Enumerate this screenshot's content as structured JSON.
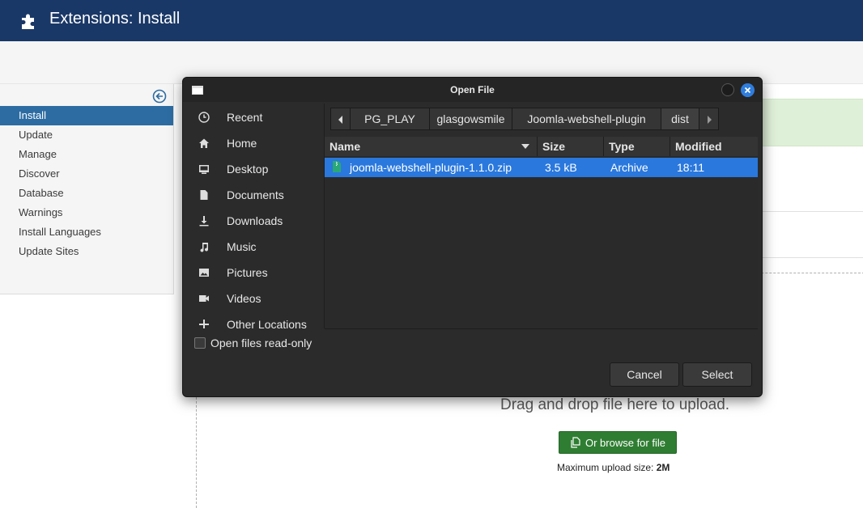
{
  "header": {
    "title": "Extensions: Install",
    "icon": "puzzle-icon"
  },
  "sidebar": {
    "items": [
      {
        "label": "Install",
        "active": true
      },
      {
        "label": "Update"
      },
      {
        "label": "Manage"
      },
      {
        "label": "Discover"
      },
      {
        "label": "Database"
      },
      {
        "label": "Warnings"
      },
      {
        "label": "Install Languages"
      },
      {
        "label": "Update Sites"
      }
    ]
  },
  "upload": {
    "drag_text": "Drag and drop file here to upload.",
    "browse_label": "Or browse for file",
    "max_label": "Maximum upload size:",
    "max_value": "2M"
  },
  "dialog": {
    "title": "Open File",
    "places": [
      {
        "label": "Recent",
        "icon": "clock-icon"
      },
      {
        "label": "Home",
        "icon": "home-icon"
      },
      {
        "label": "Desktop",
        "icon": "desktop-icon"
      },
      {
        "label": "Documents",
        "icon": "document-icon"
      },
      {
        "label": "Downloads",
        "icon": "download-icon"
      },
      {
        "label": "Music",
        "icon": "music-icon"
      },
      {
        "label": "Pictures",
        "icon": "picture-icon"
      },
      {
        "label": "Videos",
        "icon": "video-icon"
      },
      {
        "label": "Other Locations",
        "icon": "plus-icon"
      }
    ],
    "path": [
      "PG_PLAY",
      "glasgowsmile",
      "Joomla-webshell-plugin",
      "dist"
    ],
    "columns": {
      "name": "Name",
      "size": "Size",
      "type": "Type",
      "modified": "Modified"
    },
    "files": [
      {
        "name": "joomla-webshell-plugin-1.1.0.zip",
        "size": "3.5 kB",
        "type": "Archive",
        "modified": "18:11",
        "selected": true
      }
    ],
    "readonly_label": "Open files read-only",
    "cancel_label": "Cancel",
    "select_label": "Select"
  },
  "colors": {
    "header_bg": "#1a3867",
    "sidebar_active": "#2d6ca2",
    "browse_button": "#2f7d32",
    "dialog_bg": "#2b2b2c",
    "selection": "#2a78dd"
  }
}
